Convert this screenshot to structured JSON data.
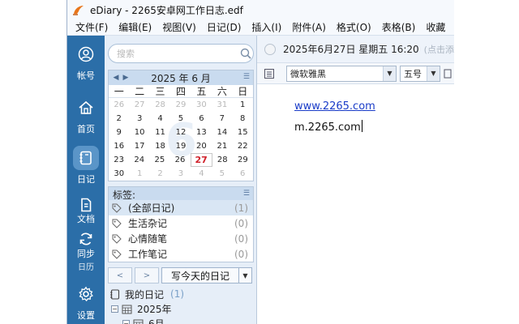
{
  "window": {
    "title": "eDiary - 2265安卓网工作日志.edf"
  },
  "menu": {
    "items": [
      "文件(F)",
      "编辑(E)",
      "视图(V)",
      "日记(D)",
      "插入(I)",
      "附件(A)",
      "格式(O)",
      "表格(B)",
      "收藏"
    ]
  },
  "nav": {
    "items": [
      {
        "label": "帐号",
        "icon": "user-circle-icon"
      },
      {
        "label": "首页",
        "icon": "home-icon"
      },
      {
        "label": "日记",
        "icon": "diary-icon",
        "active": true
      },
      {
        "label": "文档",
        "icon": "document-icon"
      },
      {
        "label": "同步",
        "icon": "sync-icon"
      },
      {
        "label": "日历",
        "icon": "calendar-icon"
      },
      {
        "label": "设置",
        "icon": "gear-icon"
      }
    ]
  },
  "search": {
    "placeholder": "搜索"
  },
  "calendar": {
    "title": "2025 年 6 月",
    "watermark": "6",
    "weekdays": [
      "一",
      "二",
      "三",
      "四",
      "五",
      "六",
      "日"
    ],
    "weeks": [
      [
        {
          "d": "26",
          "o": true
        },
        {
          "d": "27",
          "o": true
        },
        {
          "d": "28",
          "o": true
        },
        {
          "d": "29",
          "o": true
        },
        {
          "d": "30",
          "o": true
        },
        {
          "d": "31",
          "o": true
        },
        {
          "d": "1"
        }
      ],
      [
        {
          "d": "2"
        },
        {
          "d": "3"
        },
        {
          "d": "4"
        },
        {
          "d": "5"
        },
        {
          "d": "6"
        },
        {
          "d": "7"
        },
        {
          "d": "8"
        }
      ],
      [
        {
          "d": "9"
        },
        {
          "d": "10"
        },
        {
          "d": "11"
        },
        {
          "d": "12"
        },
        {
          "d": "13"
        },
        {
          "d": "14"
        },
        {
          "d": "15"
        }
      ],
      [
        {
          "d": "16"
        },
        {
          "d": "17"
        },
        {
          "d": "18"
        },
        {
          "d": "19"
        },
        {
          "d": "20"
        },
        {
          "d": "21"
        },
        {
          "d": "22"
        }
      ],
      [
        {
          "d": "23"
        },
        {
          "d": "24"
        },
        {
          "d": "25"
        },
        {
          "d": "26"
        },
        {
          "d": "27",
          "today": true
        },
        {
          "d": "28"
        },
        {
          "d": "29"
        }
      ],
      [
        {
          "d": "30"
        },
        {
          "d": "1",
          "o": true
        },
        {
          "d": "2",
          "o": true
        },
        {
          "d": "3",
          "o": true
        },
        {
          "d": "4",
          "o": true
        },
        {
          "d": "5",
          "o": true
        },
        {
          "d": "6",
          "o": true
        }
      ]
    ]
  },
  "tags": {
    "title": "标签:",
    "items": [
      {
        "name": "(全部日记)",
        "count": "(1)",
        "selected": true
      },
      {
        "name": "生活杂记",
        "count": "(0)"
      },
      {
        "name": "心情随笔",
        "count": "(0)"
      },
      {
        "name": "工作笔记",
        "count": "(0)"
      }
    ]
  },
  "buttons": {
    "prev": "<",
    "next": ">",
    "write_today": "写今天的日记"
  },
  "tree": {
    "root": {
      "label": "我的日记",
      "count": "(1)"
    },
    "year": "2025年",
    "month": "6月"
  },
  "editor": {
    "date": "2025年6月27日 星期五 16:20",
    "hint": "(点击添",
    "font": "微软雅黑",
    "size": "五号",
    "lines": [
      "www.2265.com",
      "m.2265.com"
    ]
  },
  "colors": {
    "nav_bg": "#2b6ea8",
    "today": "#d0202a",
    "link": "#1a3cc8"
  }
}
